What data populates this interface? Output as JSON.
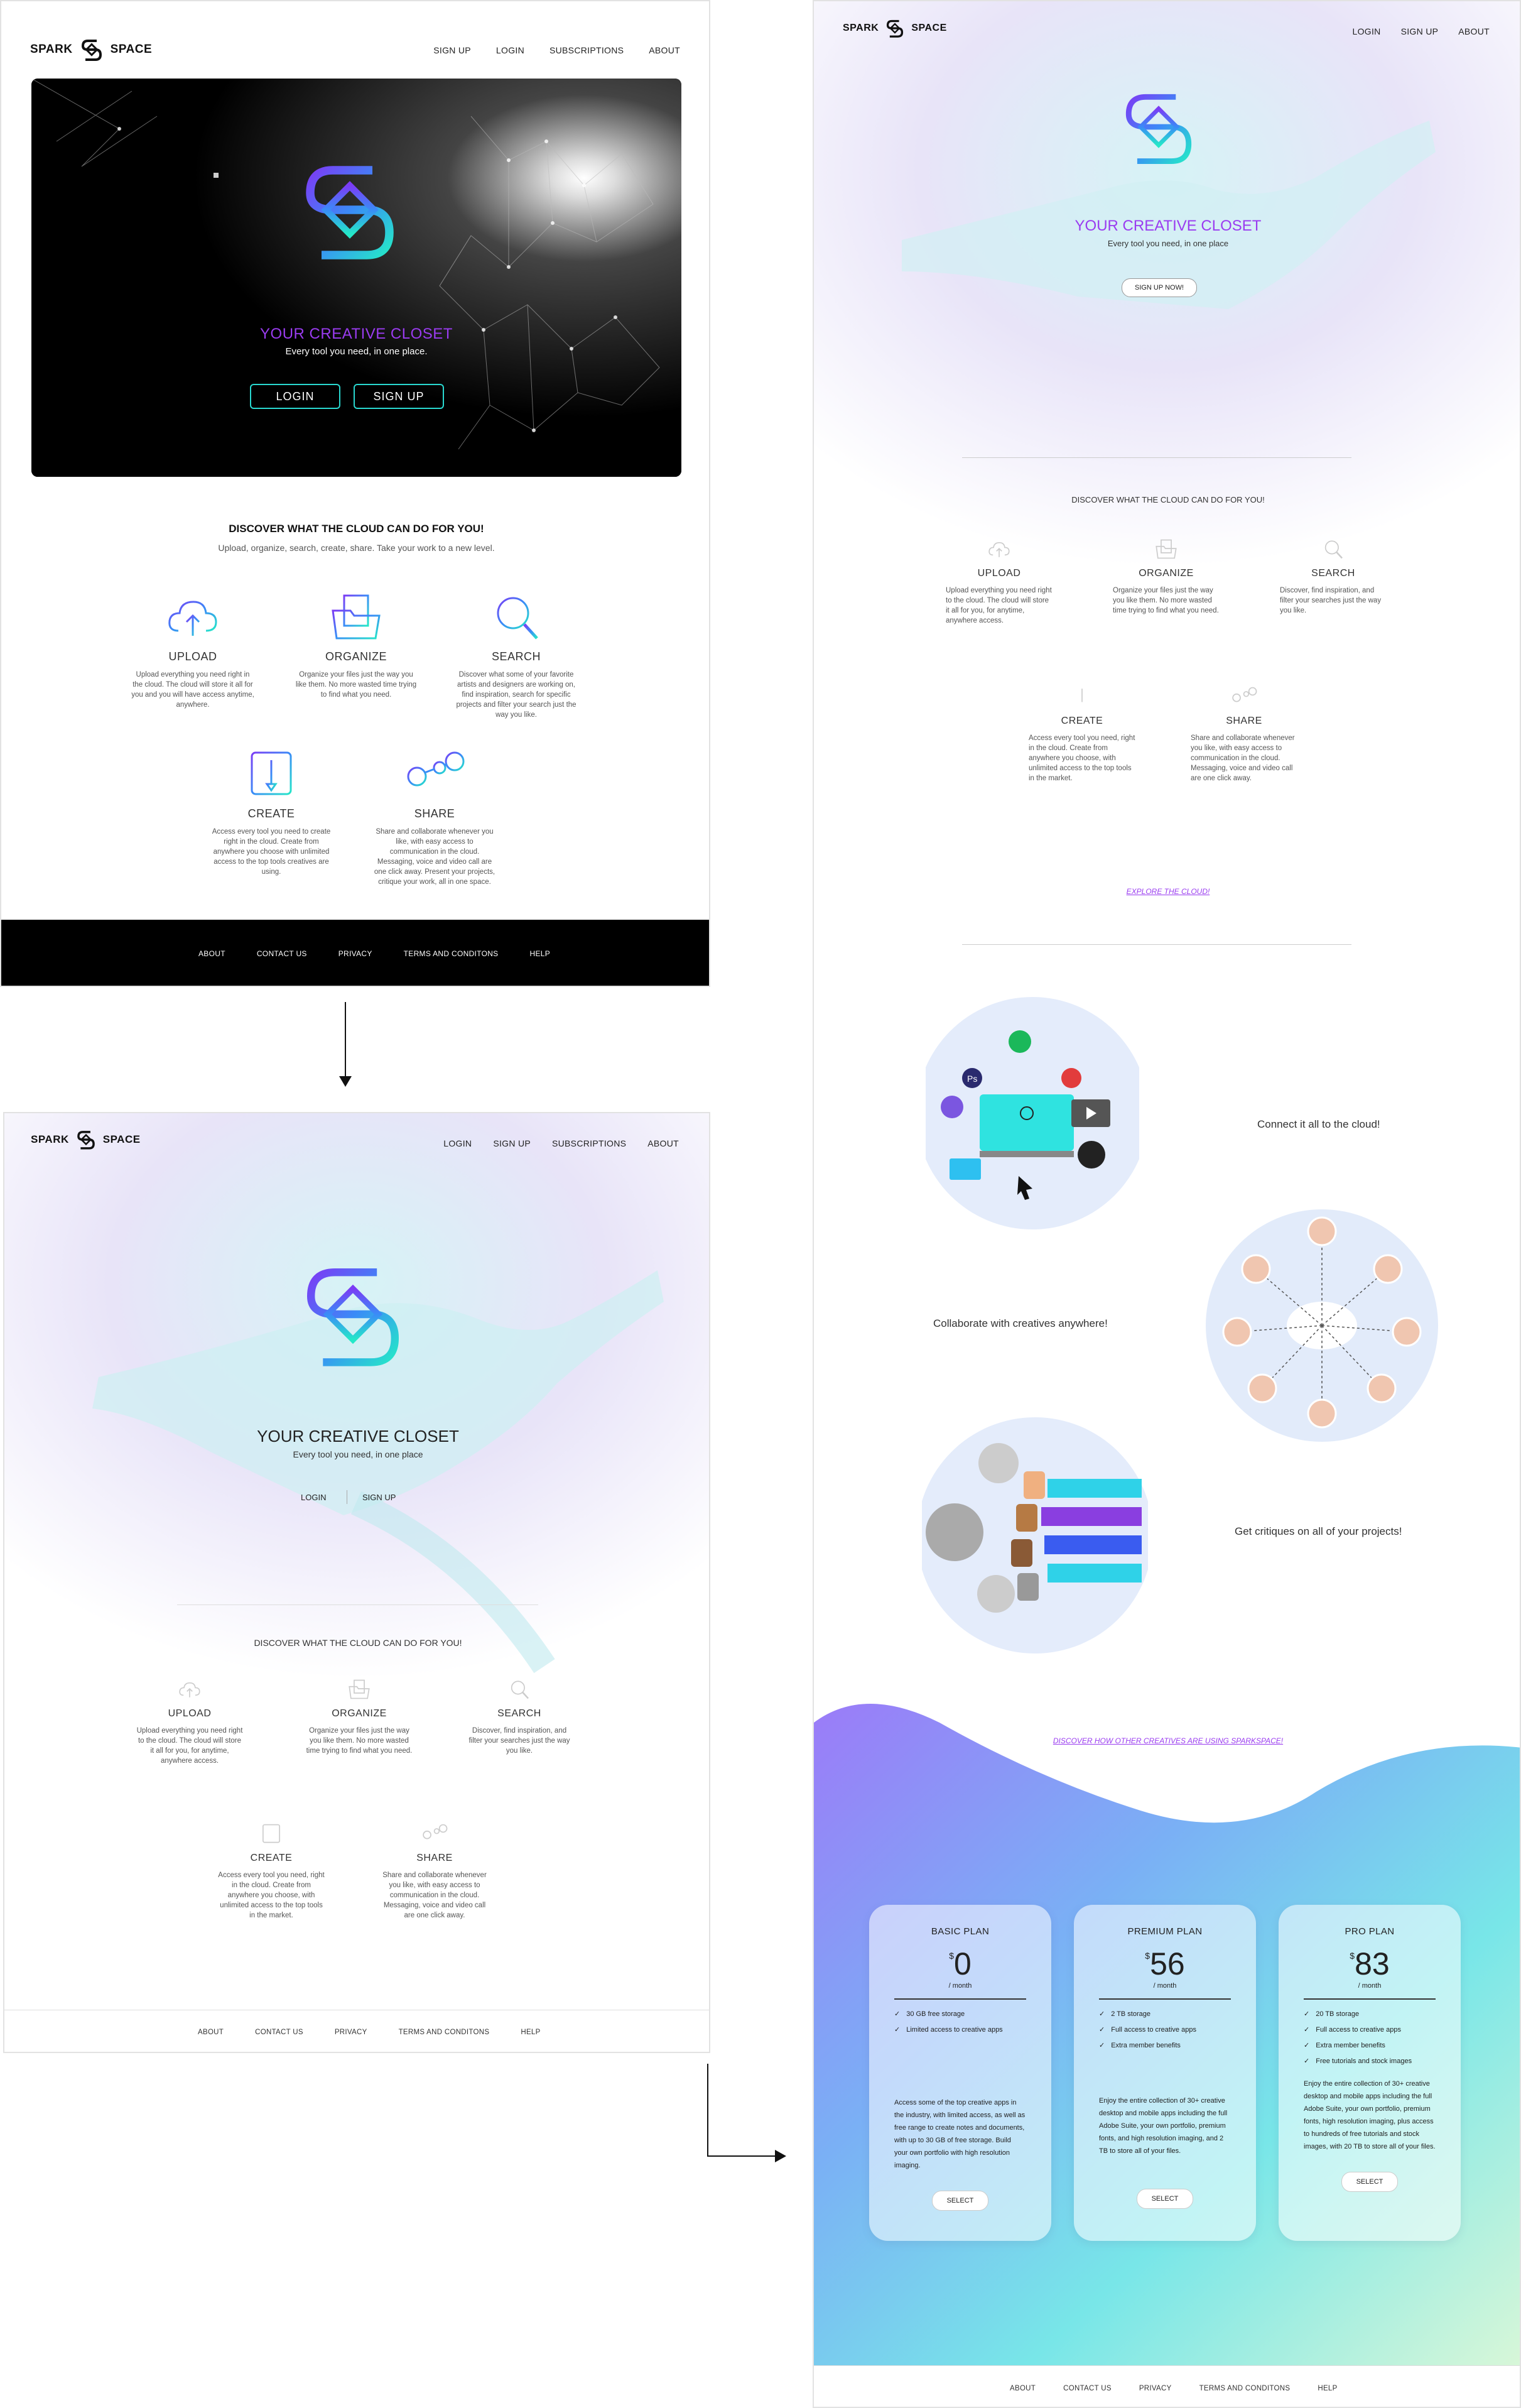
{
  "brand": {
    "left": "SPARK",
    "right": "SPACE"
  },
  "v1": {
    "nav": [
      "SIGN UP",
      "LOGIN",
      "SUBSCRIPTIONS",
      "ABOUT"
    ],
    "hero_title": "YOUR CREATIVE CLOSET",
    "hero_sub": "Every tool you need, in one place.",
    "login_btn": "LOGIN",
    "signup_btn": "SIGN UP",
    "discover_title": "DISCOVER WHAT THE CLOUD CAN DO FOR YOU!",
    "discover_sub": "Upload, organize, search, create, share. Take your work to a new level.",
    "features": [
      {
        "label": "UPLOAD",
        "desc": "Upload everything you need right in the cloud. The cloud will store it all for you and you will have access anytime, anywhere."
      },
      {
        "label": "ORGANIZE",
        "desc": "Organize your files just the way you like them. No more wasted time trying to find what you need."
      },
      {
        "label": "SEARCH",
        "desc": "Discover what some of your favorite artists and designers are working on, find inspiration, search for specific projects and filter your search just the way you like."
      },
      {
        "label": "CREATE",
        "desc": "Access every tool you need to create right in the cloud. Create from anywhere you choose with unlimited access to the top tools creatives are using."
      },
      {
        "label": "SHARE",
        "desc": "Share and collaborate whenever you like, with easy access to communication in the cloud. Messaging, voice and video call are one click away. Present your projects, critique your work, all in one space."
      }
    ],
    "footer": [
      "ABOUT",
      "CONTACT US",
      "PRIVACY",
      "TERMS AND CONDITONS",
      "HELP"
    ]
  },
  "v2": {
    "nav": [
      "LOGIN",
      "SIGN UP",
      "SUBSCRIPTIONS",
      "ABOUT"
    ],
    "hero_title": "YOUR CREATIVE CLOSET",
    "hero_sub": "Every tool you need, in one place",
    "login": "LOGIN",
    "signup": "SIGN UP",
    "discover_title": "DISCOVER WHAT THE CLOUD CAN DO FOR YOU!",
    "features": [
      {
        "label": "UPLOAD",
        "desc": "Upload everything you need right to the cloud. The cloud will store it all for you, for anytime, anywhere access."
      },
      {
        "label": "ORGANIZE",
        "desc": "Organize your files just the way you like them. No more wasted time trying to find what you need."
      },
      {
        "label": "SEARCH",
        "desc": "Discover, find inspiration, and filter your searches just the way you like."
      },
      {
        "label": "CREATE",
        "desc": "Access every tool you need, right in the cloud. Create from anywhere you choose, with unlimited access to the top tools in the market."
      },
      {
        "label": "SHARE",
        "desc": "Share and collaborate whenever you like, with easy access to communication in the cloud. Messaging, voice and video call are one click away."
      }
    ],
    "footer": [
      "ABOUT",
      "CONTACT US",
      "PRIVACY",
      "TERMS AND CONDITONS",
      "HELP"
    ]
  },
  "v3": {
    "nav": [
      "LOGIN",
      "SIGN UP",
      "ABOUT"
    ],
    "hero_title": "YOUR CREATIVE CLOSET",
    "hero_sub": "Every tool you need, in one place",
    "signup_btn": "SIGN UP NOW!",
    "discover_title": "DISCOVER WHAT THE CLOUD CAN DO FOR YOU!",
    "features": [
      {
        "label": "UPLOAD",
        "desc": "Upload everything you need right to the cloud. The cloud will store it all for you, for anytime, anywhere access."
      },
      {
        "label": "ORGANIZE",
        "desc": "Organize your files just the way you like them. No more wasted time trying to find what you need."
      },
      {
        "label": "SEARCH",
        "desc": "Discover, find inspiration, and filter your searches just the way you like."
      },
      {
        "label": "CREATE",
        "desc": "Access every tool you need, right in the cloud. Create from anywhere you choose, with unlimited access to the top tools in the market."
      },
      {
        "label": "SHARE",
        "desc": "Share and collaborate whenever you like, with easy access to communication in the cloud. Messaging, voice and video call are one click away."
      }
    ],
    "explore": "EXPLORE THE CLOUD!",
    "captions": [
      "Connect it all to the cloud!",
      "Collaborate with creatives anywhere!",
      "Get critiques on all of your projects!"
    ],
    "discover_others": "DISCOVER HOW OTHER CREATIVES ARE USING SPARKSPACE!",
    "plans": [
      {
        "name": "BASIC PLAN",
        "currency": "$",
        "price": "0",
        "period": "/ month",
        "features": [
          "30 GB free storage",
          "Limited access to creative apps"
        ],
        "desc": "Access some of the top creative apps in the industry, with limited access, as well as free range to create notes and documents, with up to 30 GB of free storage. Build your own portfolio with high resolution imaging.",
        "select": "SELECT"
      },
      {
        "name": "PREMIUM PLAN",
        "currency": "$",
        "price": "56",
        "period": "/ month",
        "features": [
          "2 TB storage",
          "Full access to creative apps",
          "Extra member benefits"
        ],
        "desc": "Enjoy the entire collection of 30+ creative desktop and mobile apps including the full Adobe Suite, your own portfolio, premium fonts, and high resolution imaging, and 2 TB to store all of your files.",
        "select": "SELECT"
      },
      {
        "name": "PRO PLAN",
        "currency": "$",
        "price": "83",
        "period": "/ month",
        "features": [
          "20 TB storage",
          "Full access to creative apps",
          "Extra member benefits",
          "Free tutorials and stock images"
        ],
        "desc": "Enjoy the entire collection of 30+ creative desktop and mobile apps including the full Adobe Suite, your own portfolio, premium fonts, high resolution imaging, plus access to hundreds of free tutorials and stock images, with 20 TB to store all of your files.",
        "select": "SELECT"
      }
    ],
    "footer": [
      "ABOUT",
      "CONTACT US",
      "PRIVACY",
      "TERMS AND CONDITONS",
      "HELP"
    ]
  },
  "colors": {
    "purple": "#9a3cf0",
    "teal": "#22e0d0",
    "blue": "#4a6cf7",
    "black": "#000000"
  }
}
